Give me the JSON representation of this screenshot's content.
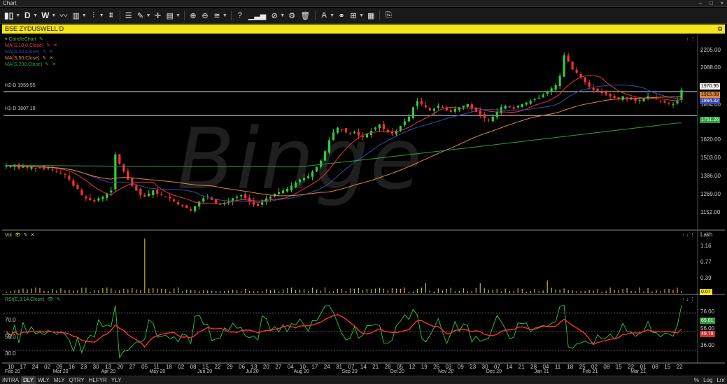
{
  "window": {
    "title": "Chart",
    "controls": [
      "–",
      "□",
      "×"
    ]
  },
  "toolbar": {
    "items": [
      {
        "name": "chart-type-candle-icon",
        "glyph": "▮▯"
      },
      {
        "name": "period-daily-button",
        "glyph": "D"
      },
      {
        "name": "period-weekly-button",
        "glyph": "W"
      },
      {
        "name": "line-style-icon",
        "glyph": "〰"
      },
      {
        "name": "bar-style-icon",
        "glyph": "▥"
      },
      {
        "name": "indicator-icon",
        "glyph": "⫶"
      },
      {
        "name": "studies-icon",
        "glyph": "⩩"
      },
      {
        "name": "list-icon",
        "glyph": "☰"
      },
      {
        "name": "draw-tools-icon",
        "glyph": "✎"
      },
      {
        "name": "crosshair-icon",
        "glyph": "✛"
      },
      {
        "name": "layout-icon",
        "glyph": "▤"
      },
      {
        "name": "zoom-in-icon",
        "glyph": "⊕"
      },
      {
        "name": "zoom-out-icon",
        "glyph": "⊖"
      },
      {
        "name": "compare-icon",
        "glyph": "≋"
      },
      {
        "name": "help-icon",
        "glyph": "?"
      },
      {
        "name": "volume-icon",
        "glyph": "▁▃▅"
      },
      {
        "name": "hide-icon",
        "glyph": "⊘"
      },
      {
        "name": "settings-gear-icon",
        "glyph": "⚙"
      },
      {
        "name": "delete-trash-icon",
        "glyph": "🗑"
      },
      {
        "name": "text-annotation-icon",
        "glyph": "A"
      },
      {
        "name": "link-icon",
        "glyph": "⚭"
      },
      {
        "name": "grid-icon",
        "glyph": "⊞"
      },
      {
        "name": "table-icon",
        "glyph": "▦"
      },
      {
        "name": "export-document-icon",
        "glyph": "⎘"
      }
    ]
  },
  "symbol": {
    "label": "BSE ZYDUSWELL D"
  },
  "price_pane": {
    "legend": [
      {
        "label": "CandleChart",
        "color": "#4caf50"
      },
      {
        "label": "MA(S,10,0,Close)",
        "color": "#e53935"
      },
      {
        "label": "MA(S,20,Close)",
        "color": "#3949ab"
      },
      {
        "label": "MA(S,50,Close)",
        "color": "#e0873a"
      },
      {
        "label": "MA(S,200,Close)",
        "color": "#2e9e3b"
      }
    ],
    "hlines": [
      {
        "label": "H2-D 1959.55",
        "value": 1959.55
      },
      {
        "label": "H1-D 1807.19",
        "value": 1807.19
      }
    ],
    "y_ticks": [
      "2205.00",
      "2088.00",
      "1854.00",
      "1620.00",
      "1503.00",
      "1386.00",
      "1269.00",
      "1152.00"
    ],
    "badges": [
      {
        "label": "1970.95",
        "bg": "#f2f2f2",
        "fg": "#000"
      },
      {
        "label": "1915.08",
        "bg": "#e0873a",
        "fg": "#000"
      },
      {
        "label": "1894.32",
        "bg": "#3949ab",
        "fg": "#fff"
      },
      {
        "label": "1751.26",
        "bg": "#2e9e3b",
        "fg": "#fff"
      }
    ],
    "watermark": "Binge"
  },
  "volume_pane": {
    "legend": "Vol",
    "unit": "Lakh",
    "y_ticks": [
      "1.16",
      "0.77",
      "0.39"
    ],
    "badge": "0.07"
  },
  "rsi_pane": {
    "legend": "RSI(E,9,14,Close)",
    "y_ticks_left": [
      "70.0",
      "50.0",
      "30.0"
    ],
    "y_ticks_right": [
      "76.00",
      "56.00",
      "36.00"
    ],
    "badges": [
      {
        "label": "65.01",
        "bg": "#2e9e3b"
      },
      {
        "label": "49.78",
        "bg": "#d32f2f"
      }
    ]
  },
  "x_axis": {
    "days": [
      "10",
      "17",
      "24",
      "02",
      "09",
      "16",
      "23",
      "30",
      "13",
      "20",
      "27",
      "05",
      "11",
      "18",
      "02",
      "08",
      "15",
      "22",
      "29",
      "06",
      "13",
      "20",
      "27",
      "04",
      "10",
      "17",
      "24",
      "31",
      "07",
      "14",
      "21",
      "28",
      "05",
      "12",
      "19",
      "26",
      "03",
      "09",
      "23",
      "30",
      "07",
      "14",
      "21",
      "28",
      "04",
      "11",
      "18",
      "25",
      "02",
      "08",
      "15",
      "22",
      "01",
      "08",
      "15",
      "22"
    ],
    "months": [
      "Feb 20",
      "Mar 20",
      "Apr 20",
      "May 20",
      "Jun 20",
      "Jul 20",
      "Aug 20",
      "Sep 20",
      "Oct 20",
      "Nov 20",
      "Dec 20",
      "Jan 21",
      "Feb 21",
      "Mar 21"
    ]
  },
  "footer": {
    "tabs": [
      "INTRA",
      "DLY",
      "WLY",
      "MLY",
      "QTRY",
      "HLFYR",
      "YLY"
    ],
    "active": "DLY",
    "right": [
      "%",
      "Log",
      "Lnr"
    ]
  },
  "chart_data": {
    "type": "candlestick",
    "price_range": [
      1100,
      2280
    ],
    "closes": [
      1490,
      1480,
      1495,
      1470,
      1485,
      1475,
      1480,
      1470,
      1478,
      1465,
      1470,
      1460,
      1450,
      1440,
      1430,
      1400,
      1360,
      1340,
      1300,
      1280,
      1270,
      1260,
      1280,
      1290,
      1310,
      1330,
      1560,
      1500,
      1450,
      1400,
      1360,
      1330,
      1300,
      1290,
      1310,
      1330,
      1310,
      1300,
      1290,
      1280,
      1260,
      1240,
      1230,
      1220,
      1200,
      1230,
      1260,
      1280,
      1290,
      1270,
      1250,
      1240,
      1250,
      1260,
      1280,
      1290,
      1300,
      1280,
      1260,
      1240,
      1230,
      1260,
      1280,
      1290,
      1310,
      1320,
      1330,
      1340,
      1360,
      1380,
      1400,
      1410,
      1420,
      1450,
      1480,
      1520,
      1580,
      1650,
      1700,
      1730,
      1720,
      1700,
      1690,
      1700,
      1680,
      1670,
      1690,
      1710,
      1730,
      1750,
      1720,
      1700,
      1690,
      1710,
      1740,
      1770,
      1800,
      1860,
      1900,
      1880,
      1860,
      1840,
      1850,
      1870,
      1860,
      1840,
      1830,
      1850,
      1860,
      1870,
      1880,
      1850,
      1830,
      1810,
      1790,
      1780,
      1800,
      1830,
      1860,
      1870,
      1860,
      1850,
      1870,
      1880,
      1890,
      1900,
      1910,
      1920,
      1940,
      1960,
      1980,
      2000,
      2060,
      2190,
      2150,
      2100,
      2080,
      2050,
      2020,
      1990,
      1970,
      1960,
      1950,
      1940,
      1930,
      1920,
      1910,
      1930,
      1920,
      1910,
      1900,
      1905,
      1915,
      1930,
      1920,
      1910,
      1900,
      1890,
      1885,
      1880,
      1900,
      1970
    ]
  }
}
